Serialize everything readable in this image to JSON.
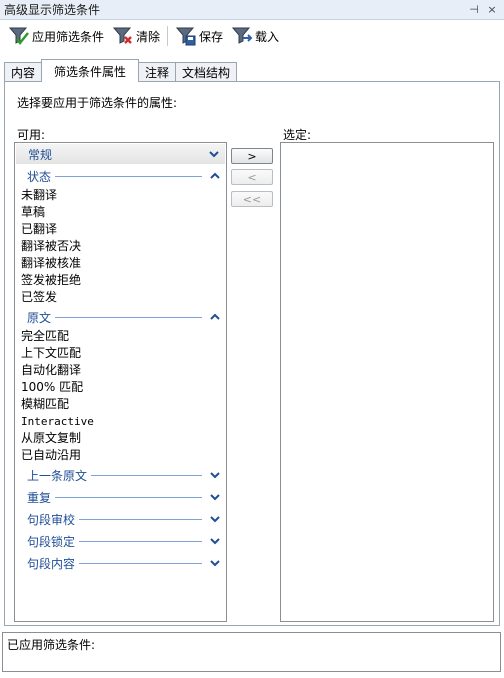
{
  "window": {
    "title": "高级显示筛选条件",
    "pin_icon": "pin-icon",
    "close_icon": "close-icon"
  },
  "toolbar": {
    "apply_label": "应用筛选条件",
    "clear_label": "清除",
    "save_label": "保存",
    "load_label": "载入"
  },
  "tabs": [
    {
      "label": "内容"
    },
    {
      "label": "筛选条件属性"
    },
    {
      "label": "注释"
    },
    {
      "label": "文档结构"
    }
  ],
  "panel": {
    "prompt": "选择要应用于筛选条件的属性:",
    "available_label": "可用:",
    "selected_label": "选定:"
  },
  "buttons": {
    "add": ">",
    "remove": "<",
    "remove_all": "<<"
  },
  "groups": [
    {
      "title": "常规",
      "expanded": false,
      "items": []
    },
    {
      "title": "状态",
      "expanded": true,
      "items": [
        "未翻译",
        "草稿",
        "已翻译",
        "翻译被否决",
        "翻译被核准",
        "签发被拒绝",
        "已签发"
      ]
    },
    {
      "title": "原文",
      "expanded": true,
      "items": [
        "完全匹配",
        "上下文匹配",
        "自动化翻译",
        "100% 匹配",
        "模糊匹配",
        "Interactive",
        "从原文复制",
        "已自动沿用"
      ]
    },
    {
      "title": "上一条原文",
      "expanded": false,
      "items": []
    },
    {
      "title": "重复",
      "expanded": false,
      "items": []
    },
    {
      "title": "句段审校",
      "expanded": false,
      "items": []
    },
    {
      "title": "句段锁定",
      "expanded": false,
      "items": []
    },
    {
      "title": "句段内容",
      "expanded": false,
      "items": []
    }
  ],
  "status": {
    "label": "已应用筛选条件:"
  },
  "colors": {
    "group_title": "#1f4e96",
    "group_line": "#7fa3d6",
    "border": "#8a8f96"
  }
}
